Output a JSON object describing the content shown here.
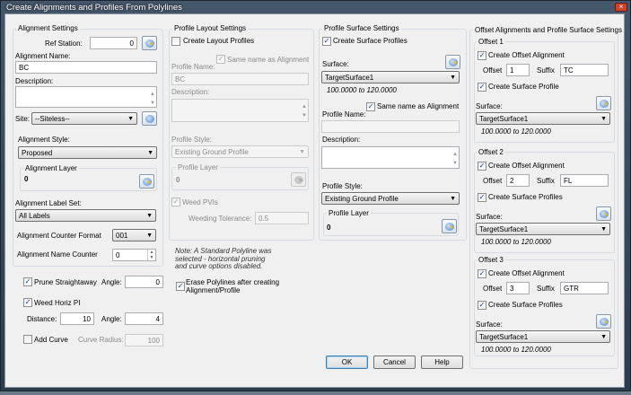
{
  "window": {
    "title": "Create Alignments and Profiles From Polylines",
    "close_icon": "×"
  },
  "alignment": {
    "group": "Alignment Settings",
    "ref_station_label": "Ref Station:",
    "ref_station": "0",
    "name_label": "Alignment Name:",
    "name": "BC",
    "description_label": "Description:",
    "description": "",
    "site_label": "Site:",
    "site": "--Siteless--",
    "style_label": "Alignment Style:",
    "style": "Proposed",
    "layer_group": "Alignment Layer",
    "layer": "0",
    "label_set_label": "Alignment Label Set:",
    "label_set": "All Labels",
    "counter_format_label": "Alignment Counter Format",
    "counter_format": "001",
    "name_counter_label": "Alignment Name Counter",
    "name_counter": "0"
  },
  "horizontal": {
    "prune_label": "Prune Straightaway",
    "prune_checked": true,
    "prune_angle_label": "Angle:",
    "prune_angle": "0",
    "weed_label": "Weed Horiz PI",
    "weed_checked": true,
    "distance_label": "Distance:",
    "distance": "10",
    "angle_label": "Angle:",
    "angle": "4",
    "add_curve_label": "Add Curve",
    "add_curve_checked": false,
    "curve_radius_label": "Curve Radius:",
    "curve_radius": "100"
  },
  "profile_layout": {
    "group": "Profile Layout Settings",
    "create_label": "Create Layout Profiles",
    "create_checked": false,
    "same_name_label": "Same name as Alignment",
    "same_name_checked": true,
    "name_label": "Profile Name:",
    "name": "BC",
    "description_label": "Description:",
    "style_label": "Profile Style:",
    "style": "Existing Ground Profile",
    "layer_group": "Profile Layer",
    "layer": "0",
    "weed_label": "Weed PVIs",
    "weed_checked": true,
    "tolerance_label": "Weeding Tolerance:",
    "tolerance": "0.5"
  },
  "note": "Note: A Standard Polyline was selected - horizontal pruning and curve options disabled.",
  "erase": {
    "label": "Erase Polylines after creating Alignment/Profile",
    "checked": true
  },
  "profile_surface": {
    "group": "Profile Surface Settings",
    "create_label": "Create Surface Profiles",
    "create_checked": true,
    "surface_label": "Surface:",
    "surface": "TargetSurface1",
    "range": "100.0000 to 120.0000",
    "same_name_label": "Same name as Alignment",
    "same_name_checked": true,
    "name_label": "Profile Name:",
    "name": "",
    "description_label": "Description:",
    "style_label": "Profile Style:",
    "style": "Existing Ground Profile",
    "layer_group": "Profile Layer",
    "layer": "0"
  },
  "offsets": {
    "group": "Offset Alignments and Profile Surface Settings",
    "items": [
      {
        "title": "Offset 1",
        "create_label": "Create Offset Alignment",
        "offset_label": "Offset",
        "offset": "1",
        "suffix_label": "Suffix",
        "suffix": "TC",
        "surf_label": "Create Surface Profile",
        "surface_label": "Surface:",
        "surface": "TargetSurface1",
        "range": "100.0000 to 120.0000"
      },
      {
        "title": "Offset 2",
        "create_label": "Create Offset Alignment",
        "offset_label": "Offset",
        "offset": "2",
        "suffix_label": "Suffix",
        "suffix": "FL",
        "surf_label": "Create Surface Profiles",
        "surface_label": "Surface:",
        "surface": "TargetSurface1",
        "range": "100.0000 to 120.0000"
      },
      {
        "title": "Offset 3",
        "create_label": "Create Offset Alignment",
        "offset_label": "Offset",
        "offset": "3",
        "suffix_label": "Suffix",
        "suffix": "GTR",
        "surf_label": "Create Surface Profiles",
        "surface_label": "Surface:",
        "surface": "TargetSurface1",
        "range": "100.0000 to 120.0000"
      }
    ]
  },
  "buttons": {
    "ok": "OK",
    "cancel": "Cancel",
    "help": "Help"
  }
}
